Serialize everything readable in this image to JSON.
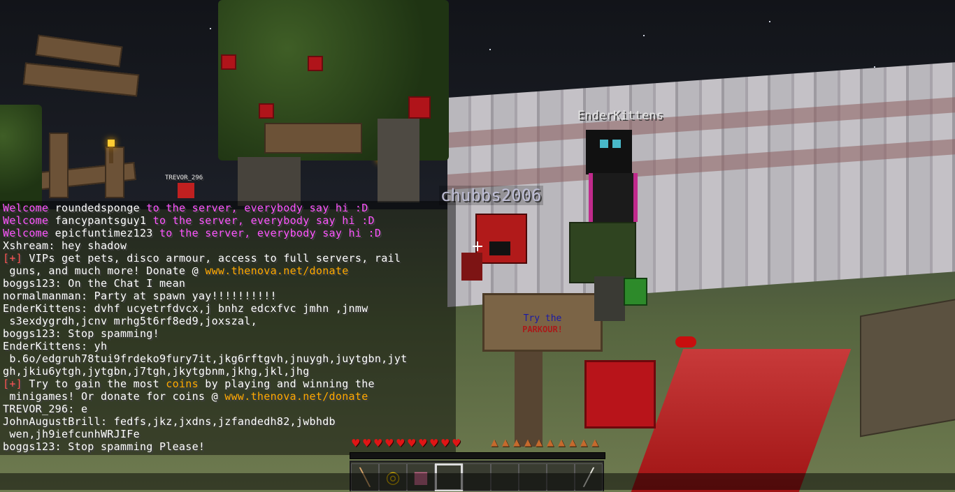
{
  "nametags": {
    "enderkittens": "EnderKittens",
    "chubbs": "chubbs2006",
    "trevor": "TREVOR_296"
  },
  "sign": {
    "line1": "Try the",
    "line2": "PARKOUR!"
  },
  "chat": [
    {
      "segments": [
        {
          "text": "Welcome ",
          "color": "pink"
        },
        {
          "text": "roundedsponge",
          "color": "white"
        },
        {
          "text": " to the server, everybody say hi :D",
          "color": "pink"
        }
      ]
    },
    {
      "segments": [
        {
          "text": "Welcome ",
          "color": "pink"
        },
        {
          "text": "fancypantsguy1",
          "color": "white"
        },
        {
          "text": " to the server, everybody say hi :D",
          "color": "pink"
        }
      ]
    },
    {
      "segments": [
        {
          "text": "Welcome ",
          "color": "pink"
        },
        {
          "text": "epicfuntimez123",
          "color": "white"
        },
        {
          "text": " to the server, everybody say hi :D",
          "color": "pink"
        }
      ]
    },
    {
      "segments": [
        {
          "text": "Xshream: hey shadow",
          "color": "white"
        }
      ]
    },
    {
      "segments": [
        {
          "text": "[+]",
          "color": "red"
        },
        {
          "text": " VIPs get pets, disco armour, access to full servers, rail",
          "color": "white"
        }
      ]
    },
    {
      "segments": [
        {
          "text": " guns, and much more! Donate @ ",
          "color": "white"
        },
        {
          "text": "www.thenova.net/donate",
          "color": "gold"
        }
      ]
    },
    {
      "segments": [
        {
          "text": "boggs123: On the Chat I mean",
          "color": "white"
        }
      ]
    },
    {
      "segments": [
        {
          "text": "normalmanman: Party at spawn yay!!!!!!!!!!",
          "color": "white"
        }
      ]
    },
    {
      "segments": [
        {
          "text": "EnderKittens: dvhf ucyetrfdvcx,j bnhz edcxfvc jmhn ,jnmw",
          "color": "white"
        }
      ]
    },
    {
      "segments": [
        {
          "text": " s3exdygrdh,jcnv mrhg5t6rf8ed9,joxszal,",
          "color": "white"
        }
      ]
    },
    {
      "segments": [
        {
          "text": "boggs123: Stop spamming!",
          "color": "white"
        }
      ]
    },
    {
      "segments": [
        {
          "text": "EnderKittens: yh",
          "color": "white"
        }
      ]
    },
    {
      "segments": [
        {
          "text": " b.6o/edgruh78tui9frdeko9fury7it,jkg6rftgvh,jnuygh,juytgbn,jyt",
          "color": "white"
        }
      ]
    },
    {
      "segments": [
        {
          "text": "gh,jkiu6ytgh,jytgbn,j7tgh,jkytgbnm,jkhg,jkl,jhg",
          "color": "white"
        }
      ]
    },
    {
      "segments": [
        {
          "text": "[+]",
          "color": "red"
        },
        {
          "text": " Try to gain the most ",
          "color": "white"
        },
        {
          "text": "coins",
          "color": "gold"
        },
        {
          "text": " by playing and winning the",
          "color": "white"
        }
      ]
    },
    {
      "segments": [
        {
          "text": " minigames! Or donate for coins @ ",
          "color": "white"
        },
        {
          "text": "www.thenova.net/donate",
          "color": "gold"
        }
      ]
    },
    {
      "segments": [
        {
          "text": "TREVOR_296: e",
          "color": "white"
        }
      ]
    },
    {
      "segments": [
        {
          "text": "JohnAugustBrill: fedfs,jkz,jxdns,jzfandedh82,jwbhdb",
          "color": "white"
        }
      ]
    },
    {
      "segments": [
        {
          "text": " wen,jh9iefcunhWRJIFe",
          "color": "white"
        }
      ]
    },
    {
      "segments": [
        {
          "text": "boggs123: Stop spamming Please!",
          "color": "white"
        }
      ]
    }
  ],
  "hud": {
    "health": 10,
    "hunger": 10,
    "xp_progress": 0,
    "selected_slot": 4,
    "hotbar": [
      {
        "slot": 1,
        "icon": "bandage-icon"
      },
      {
        "slot": 2,
        "icon": "compass-icon"
      },
      {
        "slot": 3,
        "icon": "book-icon"
      },
      {
        "slot": 4,
        "icon": ""
      },
      {
        "slot": 5,
        "icon": ""
      },
      {
        "slot": 6,
        "icon": ""
      },
      {
        "slot": 7,
        "icon": ""
      },
      {
        "slot": 8,
        "icon": ""
      },
      {
        "slot": 9,
        "icon": "bone-icon"
      }
    ]
  },
  "colors": {
    "pink": "#ff55ff",
    "red": "#ff5555",
    "gold": "#ffaa00",
    "white": "#ffffff"
  }
}
